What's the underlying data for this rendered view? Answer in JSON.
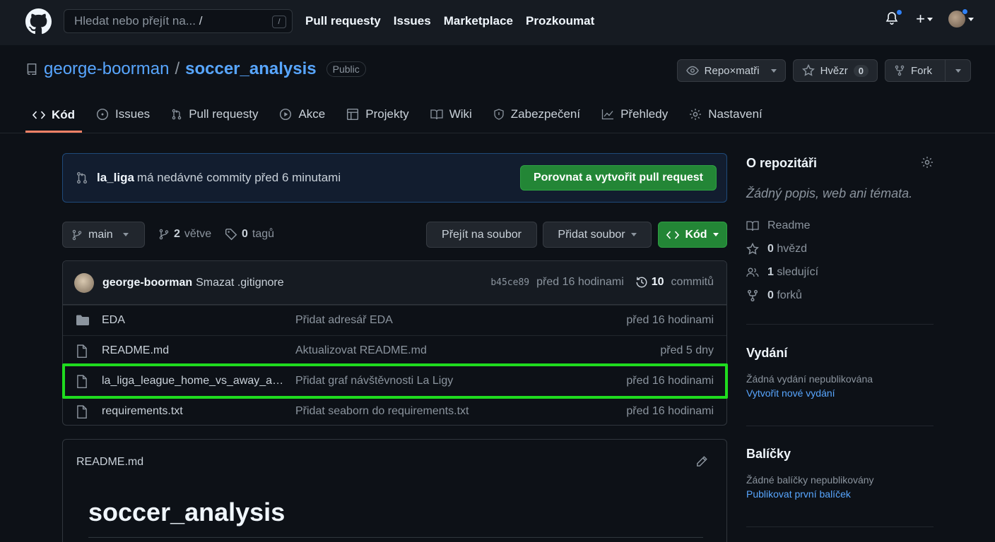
{
  "topbar": {
    "search_placeholder": "Hledat nebo přejít na...",
    "search_slash_hint": "/",
    "search_key": "/",
    "nav": [
      "Pull requesty",
      "Issues",
      "Marketplace",
      "Prozkoumat"
    ]
  },
  "repo": {
    "owner": "george-boorman",
    "separator": "/",
    "name": "soccer_analysis",
    "visibility": "Public",
    "watch_label": "Repo×matři",
    "star_label": "Hvězr",
    "star_count": "0",
    "fork_label": "Fork"
  },
  "tabs": [
    {
      "label": "Kód",
      "icon": "code-icon"
    },
    {
      "label": "Issues",
      "icon": "issue-icon"
    },
    {
      "label": "Pull requesty",
      "icon": "pull-request-icon"
    },
    {
      "label": "Akce",
      "icon": "play-icon"
    },
    {
      "label": "Projekty",
      "icon": "table-icon"
    },
    {
      "label": "Wiki",
      "icon": "book-icon"
    },
    {
      "label": "Zabezpečení",
      "icon": "shield-icon"
    },
    {
      "label": "Přehledy",
      "icon": "graph-icon"
    },
    {
      "label": "Nastavení",
      "icon": "gear-icon"
    }
  ],
  "banner": {
    "branch": "la_liga",
    "text": "má nedávné commity před 6 minutami",
    "button": "Porovnat a vytvořit pull request"
  },
  "branchbar": {
    "branch": "main",
    "branches_count": "2",
    "branches_label": "větve",
    "tags_count": "0",
    "tags_label": "tagů",
    "goto_file": "Přejít na soubor",
    "add_file": "Přidat soubor",
    "code": "Kód"
  },
  "commit": {
    "author": "george-boorman",
    "message": "Smazat .gitignore",
    "sha": "b45ce89",
    "time": "před 16 hodinami",
    "commits_count": "10",
    "commits_label": "commitů"
  },
  "files": [
    {
      "name": "EDA",
      "type": "folder",
      "message": "Přidat adresář EDA",
      "time": "před 16 hodinami"
    },
    {
      "name": "README.md",
      "type": "file",
      "message": "Aktualizovat README.md",
      "time": "před 5 dny"
    },
    {
      "name": "la_liga_league_home_vs_away_att...",
      "type": "file",
      "message": "Přidat graf návštěvnosti La Ligy",
      "time": "před 16 hodinami"
    },
    {
      "name": "requirements.txt",
      "type": "file",
      "message": "Přidat seaborn do requirements.txt",
      "time": "před 16 hodinami"
    }
  ],
  "readme": {
    "label": "README.md",
    "title": "soccer_analysis"
  },
  "sidebar": {
    "about_title": "O repozitáři",
    "about_desc": "Žádný popis, web ani témata.",
    "readme": "Readme",
    "stars_count": "0",
    "stars_label": "hvězd",
    "watching_count": "1",
    "watching_label": "sledující",
    "forks_count": "0",
    "forks_label": "forků",
    "releases_title": "Vydání",
    "releases_text": "Žádná vydání nepublikována",
    "releases_link": "Vytvořit nové vydání",
    "packages_title": "Balíčky",
    "packages_text": "Žádné balíčky nepublikovány",
    "packages_link": "Publikovat první balíček"
  },
  "colors": {
    "accent_link": "#58a6ff",
    "green_button": "#238636",
    "highlight_box": "#1fdc1f",
    "active_tab_underline": "#f78166"
  }
}
